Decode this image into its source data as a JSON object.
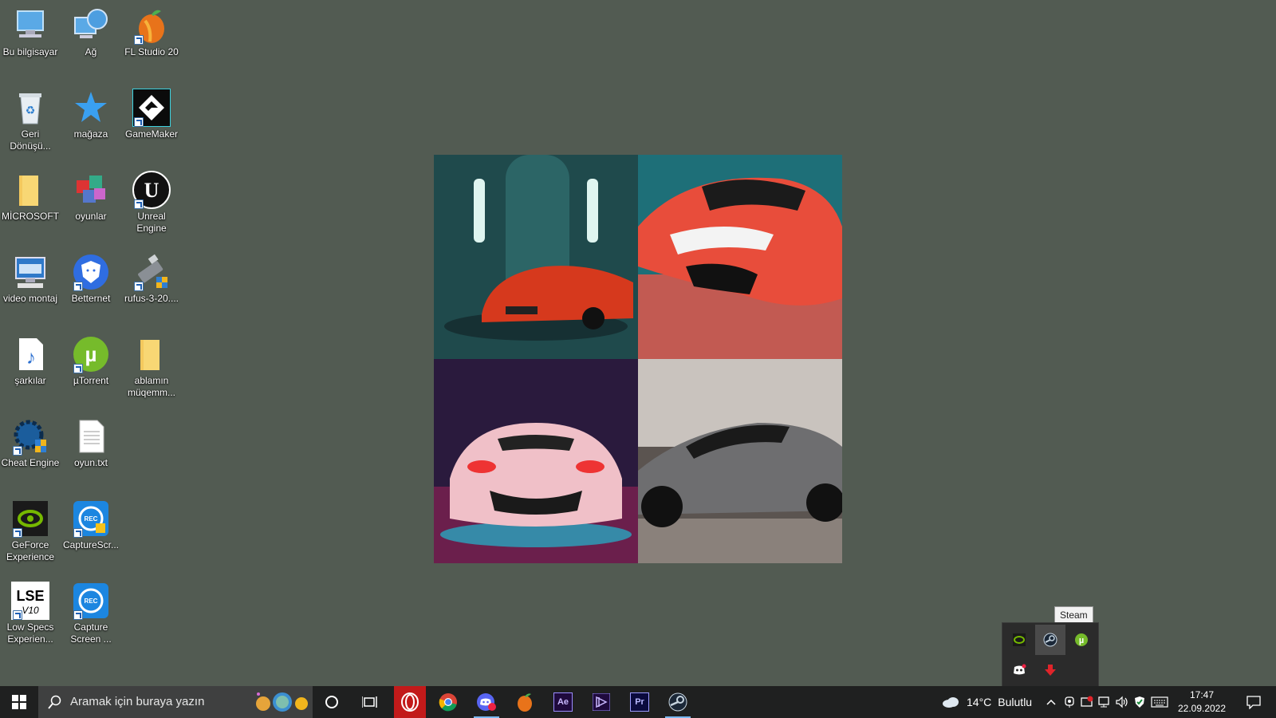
{
  "desktop": {
    "icons": [
      {
        "label": "Bu bilgisayar",
        "icon": "computer-icon"
      },
      {
        "label": "Ağ",
        "icon": "network-icon"
      },
      {
        "label": "FL Studio 20",
        "icon": "fl-studio-icon"
      },
      {
        "label": "Geri Dönüşü...",
        "icon": "recycle-bin-icon"
      },
      {
        "label": "mağaza",
        "icon": "store-star-icon"
      },
      {
        "label": "GameMaker",
        "icon": "gamemaker-icon"
      },
      {
        "label": "MİCROSOFT",
        "icon": "folder-icon"
      },
      {
        "label": "oyunlar",
        "icon": "winrar-icon"
      },
      {
        "label": "Unreal Engine",
        "icon": "unreal-engine-icon"
      },
      {
        "label": "video montaj",
        "icon": "keyboard-monitor-icon"
      },
      {
        "label": "Betternet",
        "icon": "betternet-shield-icon"
      },
      {
        "label": "rufus-3-20....",
        "icon": "usb-drive-icon"
      },
      {
        "label": "şarkılar",
        "icon": "music-file-icon"
      },
      {
        "label": "µTorrent",
        "icon": "utorrent-icon"
      },
      {
        "label": "ablamın müqemm...",
        "icon": "folder-icon"
      },
      {
        "label": "Cheat Engine",
        "icon": "cheat-engine-icon"
      },
      {
        "label": "oyun.txt",
        "icon": "text-file-icon"
      },
      {
        "label": "GeForce Experience",
        "icon": "nvidia-icon"
      },
      {
        "label": "CaptureScr...",
        "icon": "capture-screen-icon"
      },
      {
        "label": "Low Specs Experien...",
        "icon": "lse-icon"
      },
      {
        "label": "Capture Screen ...",
        "icon": "capture-screen-icon"
      }
    ]
  },
  "tray_tooltip": "Steam",
  "tray_popup": {
    "icons": [
      "nvidia-icon",
      "steam-icon",
      "utorrent-icon",
      "discord-icon",
      "download-arrow-icon"
    ]
  },
  "taskbar": {
    "search_placeholder": "Aramak için buraya yazın",
    "apps": [
      "opera-icon",
      "chrome-icon",
      "discord-icon",
      "fl-studio-icon",
      "after-effects-icon",
      "media-encoder-icon",
      "premiere-pro-icon",
      "steam-icon"
    ],
    "app_badges": {
      "Ae": "Ae",
      "Pr": "Pr"
    },
    "weather": {
      "temp": "14°C",
      "condition": "Bulutlu"
    },
    "time": "17:47",
    "date": "22.09.2022"
  },
  "colors": {
    "desktop_bg": "#525b52",
    "taskbar_bg": "#1f2020",
    "accent": "#7ab8f0"
  }
}
